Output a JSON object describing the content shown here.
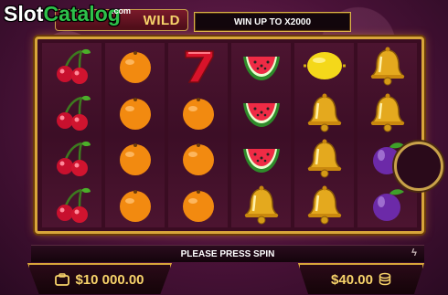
{
  "watermark": {
    "slot": "Slot",
    "catalog": "Catalog",
    "com": ".com"
  },
  "game": {
    "logo_text": "WILD"
  },
  "banner": {
    "text": "WIN UP TO X2000"
  },
  "reels": [
    [
      "cherry",
      "cherry",
      "cherry",
      "cherry"
    ],
    [
      "orange",
      "orange",
      "orange",
      "orange"
    ],
    [
      "seven",
      "orange",
      "orange",
      "orange"
    ],
    [
      "watermelon",
      "watermelon",
      "watermelon",
      "bell"
    ],
    [
      "lemon",
      "bell",
      "bell",
      "bell"
    ],
    [
      "bell",
      "bell",
      "plum",
      "plum"
    ]
  ],
  "message": "PLEASE PRESS SPIN",
  "balance": "$10 000.00",
  "bet": "$40.00",
  "icons": {
    "balance": "wallet-icon",
    "bet": "coin-stack-icon",
    "message": "lightning-icon"
  }
}
